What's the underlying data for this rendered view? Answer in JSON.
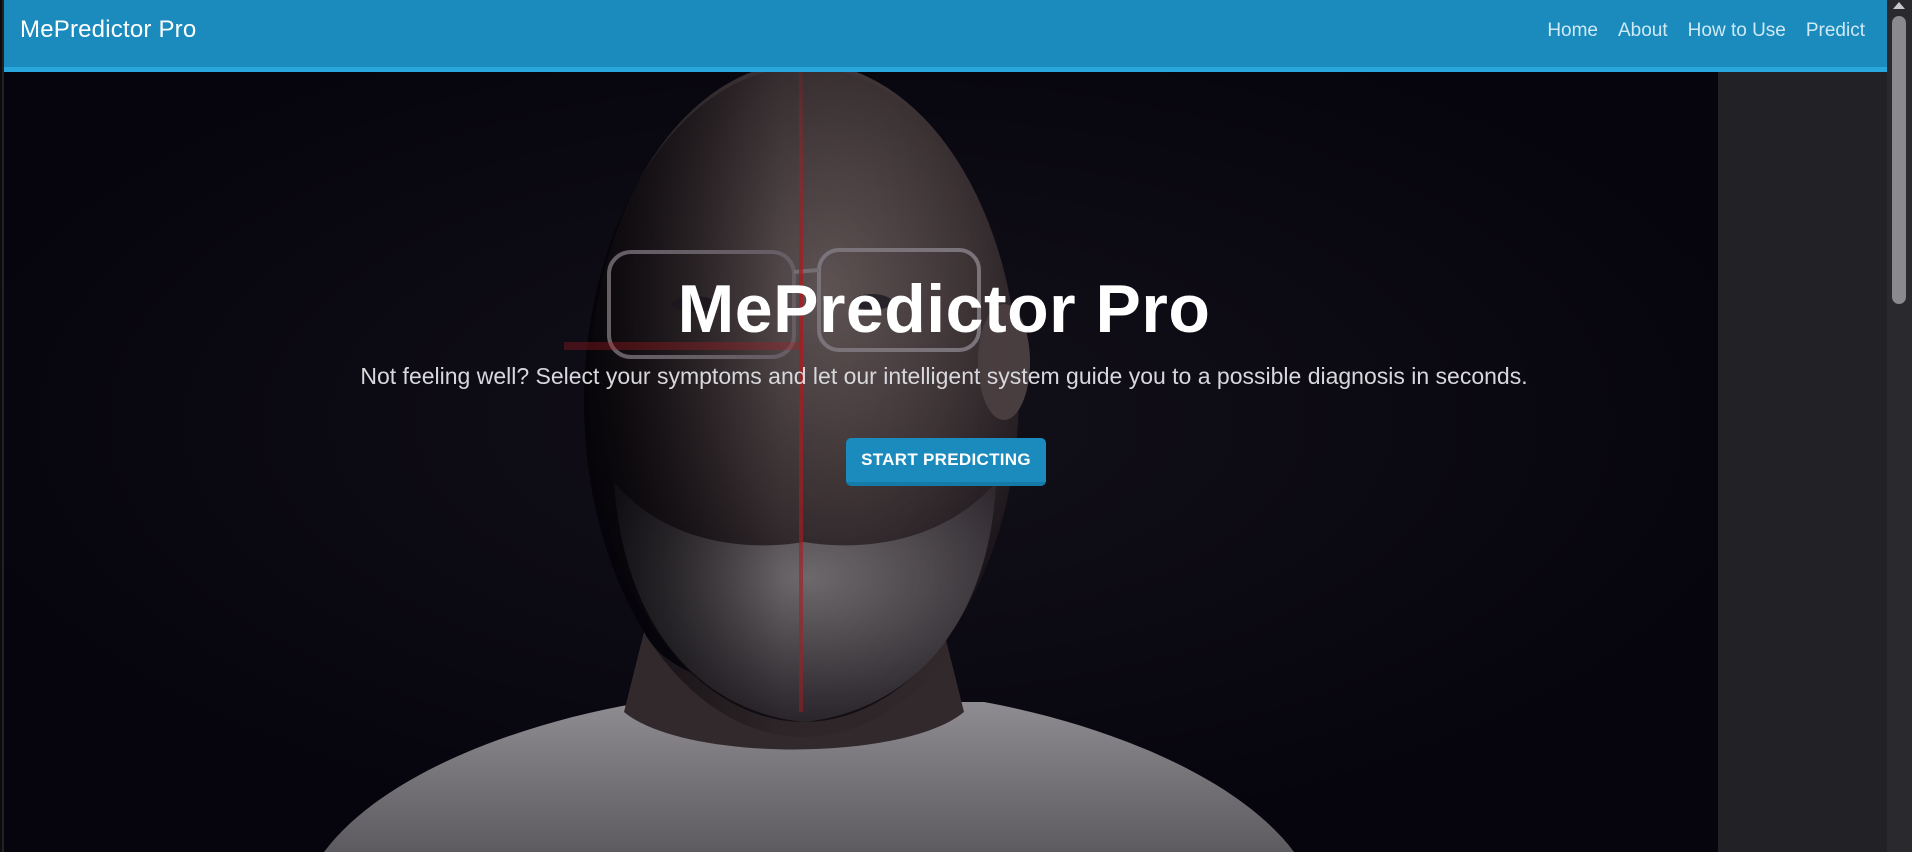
{
  "navbar": {
    "brand": "MePredictor Pro",
    "links": [
      "Home",
      "About",
      "How to Use",
      "Predict"
    ]
  },
  "hero": {
    "title": "MePredictor Pro",
    "subtitle": "Not feeling well? Select your symptoms and let our intelligent system guide you to a possible diagnosis in seconds.",
    "cta_label": "START PREDICTING",
    "background_image": "portrait of an older bald man with glasses lit by a red vertical laser line on a dark background"
  },
  "colors": {
    "navbar": "#1a8bbc",
    "navbar_border": "#29a6dc",
    "button": "#1a8bbc",
    "hero_background": "#09080e"
  }
}
